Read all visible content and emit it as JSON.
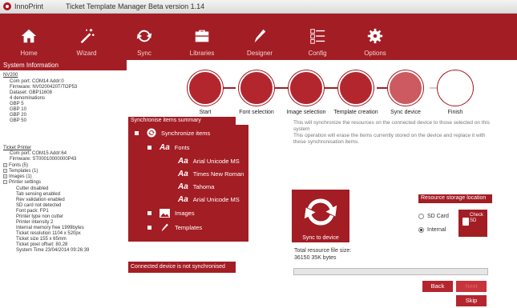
{
  "app": {
    "logo_text": "InnoPrint",
    "title": "Ticket Template Manager Beta version 1.14"
  },
  "toolbar": [
    {
      "label": "Home",
      "icon": "home-icon"
    },
    {
      "label": "Wizard",
      "icon": "wand-icon"
    },
    {
      "label": "Sync",
      "icon": "sync-icon"
    },
    {
      "label": "Libraries",
      "icon": "briefcase-icon"
    },
    {
      "label": "Designer",
      "icon": "pencil-icon"
    },
    {
      "label": "Config",
      "icon": "checklist-icon"
    },
    {
      "label": "Options",
      "icon": "gear-icon"
    }
  ],
  "sidebar": {
    "header": "System Information",
    "device1": {
      "name": "NV200",
      "lines": [
        "Com port: COM14 Addr:0",
        "Firmware: NV0200420T/TOP53",
        "Dataset: GBP11608",
        "4 denominations",
        "GBP 5",
        "GBP 10",
        "GBP 20",
        "GBP 50"
      ]
    },
    "device2": {
      "name": "Ticket Printer",
      "lines": [
        "Com port: COM15 Addr:64",
        "Firmware: ST00010000000P43"
      ],
      "tree": [
        {
          "label": "Fonts (5)"
        },
        {
          "label": "Templates (1)"
        },
        {
          "label": "Images (1)"
        },
        {
          "label": "Printer settings"
        }
      ],
      "settings": [
        "Cutter disabled",
        "Tab sensing enabled",
        "Rev validation enabled",
        "SD card not detected",
        "Font pack: FP1",
        "Printer type non cutter",
        "Printer intensity 2",
        "Internal memory free 1999bytes",
        "Ticket resolution 1104 x 520px",
        "Ticket size 155 x 65mm",
        "Ticket pixel offset: 80,28",
        "System Time 23/04/2014 09:26:39"
      ]
    }
  },
  "wizard": {
    "steps": [
      "Start",
      "Font selection",
      "Image selection",
      "Template creation",
      "Sync device",
      "Finish"
    ]
  },
  "summary": {
    "header": "Synchronise items summary",
    "root": "Synchronize items",
    "fonts_label": "Fonts",
    "fonts": [
      "Arial Unicode MS",
      "Times New Roman",
      "Tahoma",
      "Arial Unicode MS"
    ],
    "font_glyph": "Aa",
    "images_label": "Images",
    "templates_label": "Templates"
  },
  "status": "Connected device is not synchronised",
  "description": {
    "line1": "This will synchronize the resources on the connected device to those selected on this system",
    "line2": "This operation will erase the items currently stored on the device and replace it with these synchronisation items."
  },
  "sync_button": "Sync to device",
  "storage": {
    "header": "Resource storage location",
    "options": [
      "SD Card",
      "Internal"
    ],
    "selected": "Internal",
    "check_label_1": "Check",
    "check_label_2": "SD"
  },
  "total": {
    "label": "Total resource file size:",
    "value": "36150  35K bytes"
  },
  "progress": 0,
  "buttons": {
    "back": "Back",
    "next": "Next",
    "skip": "Skip"
  },
  "colors": {
    "accent": "#a31d24",
    "step_active": "#b3262e",
    "step_current": "#cc5a60"
  }
}
